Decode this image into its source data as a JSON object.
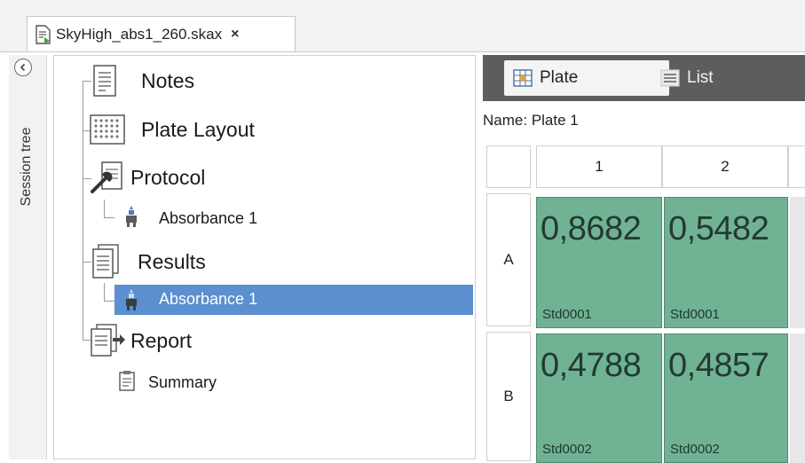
{
  "document_tab": {
    "title": "SkyHigh_abs1_260.skax",
    "close_glyph": "×"
  },
  "side_rail": {
    "label": "Session tree"
  },
  "tree": {
    "notes": "Notes",
    "plate_layout": "Plate Layout",
    "protocol": "Protocol",
    "protocol_child": "Absorbance 1",
    "results": "Results",
    "results_child": "Absorbance 1",
    "report": "Report",
    "report_child": "Summary"
  },
  "view_tabs": {
    "plate": "Plate",
    "list": "List"
  },
  "plate": {
    "name_label": "Name:",
    "name_value": "Plate 1",
    "columns": [
      "1",
      "2"
    ],
    "rows": [
      "A",
      "B"
    ],
    "wells": {
      "A1": {
        "value": "0,8682",
        "sample": "Std0001"
      },
      "A2": {
        "value": "0,5482",
        "sample": "Std0001"
      },
      "B1": {
        "value": "0,4788",
        "sample": "Std0002"
      },
      "B2": {
        "value": "0,4857",
        "sample": "Std0002"
      }
    }
  },
  "colors": {
    "well_fill": "#6fb394",
    "selection": "#5b8fcf",
    "view_tab_bar": "#5d5d5d"
  }
}
